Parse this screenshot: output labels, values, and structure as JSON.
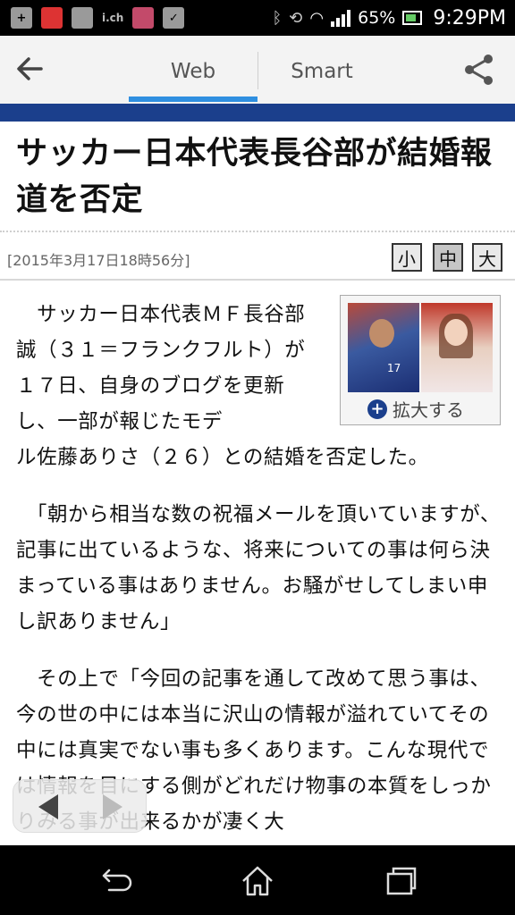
{
  "status_bar": {
    "battery_percent": "65%",
    "time": "9:29PM",
    "notif_text": "i.ch"
  },
  "app_bar": {
    "tabs": [
      {
        "label": "Web",
        "active": true
      },
      {
        "label": "Smart",
        "active": false
      }
    ],
    "accent_color": "#2f8fe0",
    "band_color": "#1b3f8c"
  },
  "article": {
    "headline": "サッカー日本代表長谷部が結婚報道を否定",
    "date": "[2015年3月17日18時56分]",
    "size_buttons": [
      "小",
      "中",
      "大"
    ],
    "active_size": "中",
    "photo_caption": "拡大する",
    "photo_number": "17",
    "paragraph1_part1": "　サッカー日本代表ＭＦ長谷部誠（３１＝フランクフルト）が１７日、自身のブログを更新し、一部が報じたモデ",
    "paragraph1_part2": "ル佐藤ありさ（２６）との結婚を否定した。",
    "paragraph2": "　「朝から相当な数の祝福メールを頂いていますが、記事に出ているような、将来についての事は何ら決まっている事はありません。お騒がせしてしまい申し訳ありません」",
    "paragraph3": "　その上で「今回の記事を通して改めて思う事は、今の世の中には本当に沢山の情報が溢れていてその中には真実でない事も多くあります。こんな現代では情報を目にする側がどれだけ物事の本質をしっかりみる事が出来るかが凄く大"
  },
  "icons": {
    "back": "back-arrow-icon",
    "share": "share-icon",
    "nav_back": "nav-back-icon",
    "nav_home": "nav-home-icon",
    "nav_recents": "nav-recents-icon"
  }
}
